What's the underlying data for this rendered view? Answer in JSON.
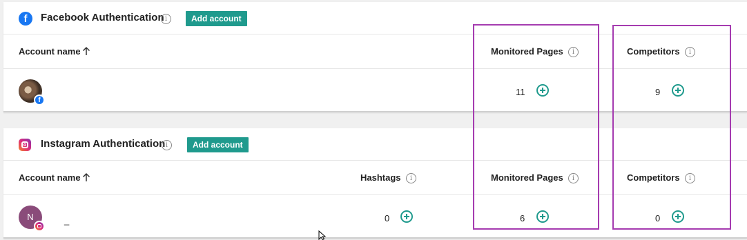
{
  "facebook": {
    "title": "Facebook Authentication",
    "add_account_label": "Add account",
    "columns": {
      "account_name": "Account name",
      "monitored_pages": "Monitored Pages",
      "competitors": "Competitors"
    },
    "row": {
      "account_name": "",
      "monitored_pages": "11",
      "competitors": "9"
    }
  },
  "instagram": {
    "title": "Instagram Authentication",
    "add_account_label": "Add account",
    "columns": {
      "account_name": "Account name",
      "hashtags": "Hashtags",
      "monitored_pages": "Monitored Pages",
      "competitors": "Competitors"
    },
    "row": {
      "avatar_letter": "N",
      "account_name": "_",
      "hashtags": "0",
      "monitored_pages": "6",
      "competitors": "0"
    }
  },
  "icons": {
    "info": "info-icon",
    "sort": "arrow-up-icon",
    "add": "plus-circle-icon",
    "facebook": "facebook-icon",
    "instagram": "instagram-icon"
  },
  "colors": {
    "accent": "#1f9a8d",
    "highlight": "#a53bb0",
    "facebook": "#1877f2"
  }
}
